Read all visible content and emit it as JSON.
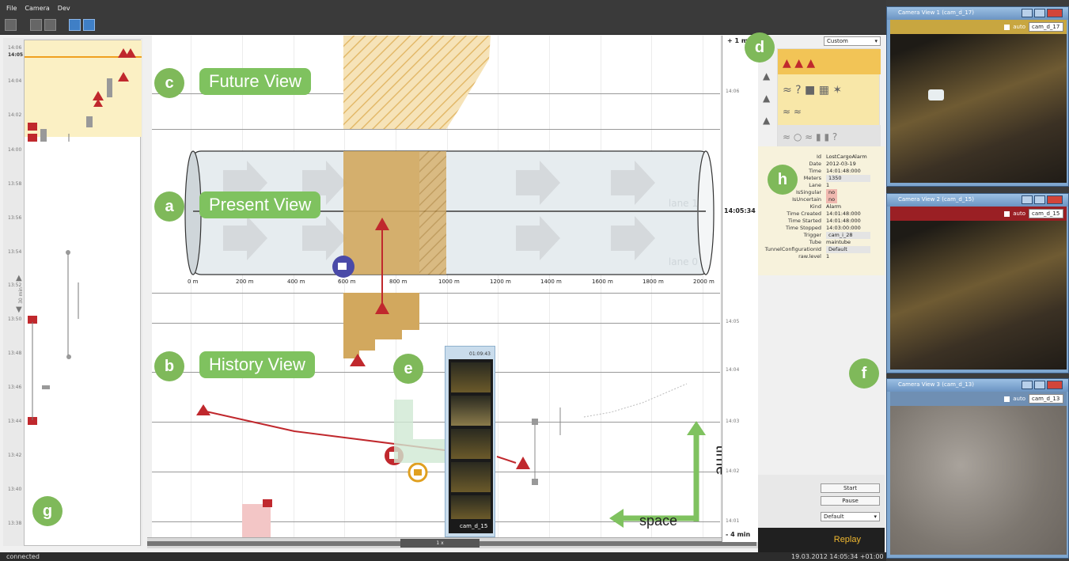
{
  "menu": [
    "File",
    "Camera",
    "Dev"
  ],
  "status": {
    "left": "connected",
    "right": "19.03.2012 14:05:34 +01:00"
  },
  "overview": {
    "ticks": [
      "14:06",
      "14:05",
      "14:04",
      "14:02",
      "14:00",
      "13:58",
      "13:56",
      "13:54",
      "13:52",
      "13:50",
      "13:48",
      "13:46",
      "13:44",
      "13:42",
      "13:40",
      "13:38"
    ],
    "zoom_label": "30 min"
  },
  "labels": {
    "a": "a",
    "b": "b",
    "c": "c",
    "d": "d",
    "e": "e",
    "f": "f",
    "g": "g",
    "h": "h",
    "future": "Future View",
    "present": "Present View",
    "history": "History View",
    "time": "time",
    "space": "space"
  },
  "tube": {
    "lane1": "lane 1",
    "lane0": "lane 0",
    "axis": [
      "0 m",
      "200 m",
      "400 m",
      "600 m",
      "800 m",
      "1000 m",
      "1200 m",
      "1400 m",
      "1600 m",
      "1800 m",
      "2000 m"
    ]
  },
  "timescale": {
    "top": "+ 1 min",
    "now": "14:05:34",
    "bottom": "- 4 min",
    "ticks": [
      "14:06",
      "14:05",
      "14:04",
      "14:03",
      "14:02",
      "14:01"
    ]
  },
  "filmstrip": {
    "time": "01:09:43",
    "camera": "cam_d_15"
  },
  "scrollbar": {
    "label": "1 x"
  },
  "right": {
    "preset": "Custom",
    "props": [
      {
        "k": "Id",
        "v": "LostCargoAlarm"
      },
      {
        "k": "Date",
        "v": "2012-03-19"
      },
      {
        "k": "Time",
        "v": "14:01:48:000"
      },
      {
        "k": "Meters",
        "v": "1350"
      },
      {
        "k": "Lane",
        "v": "1"
      },
      {
        "k": "IsSingular",
        "v": "no"
      },
      {
        "k": "IsUncertain",
        "v": "no"
      },
      {
        "k": "Kind",
        "v": "Alarm"
      },
      {
        "k": "Time Created",
        "v": "14:01:48:000"
      },
      {
        "k": "Time Started",
        "v": "14:01:48:000"
      },
      {
        "k": "Time Stopped",
        "v": "14:03:00:000"
      },
      {
        "k": "Trigger",
        "v": "cam_i_28"
      },
      {
        "k": "Tube",
        "v": "maintube"
      },
      {
        "k": "TunnelConfigurationId",
        "v": "Default"
      },
      {
        "k": "raw.level",
        "v": "1"
      }
    ],
    "start": "Start",
    "pause": "Pause",
    "mode": "Default",
    "replay": "Replay"
  },
  "cameras": [
    {
      "title": "Camera View 1 (cam_d_17)",
      "auto": "auto",
      "cam": "cam_d_17"
    },
    {
      "title": "Camera View 2 (cam_d_15)",
      "auto": "auto",
      "cam": "cam_d_15"
    },
    {
      "title": "Camera View 3 (cam_d_13)",
      "auto": "auto",
      "cam": "cam_d_13"
    }
  ],
  "colors": {
    "alarm": "#c0282d",
    "future": "#f3d99a",
    "accent": "#7fc25f"
  }
}
